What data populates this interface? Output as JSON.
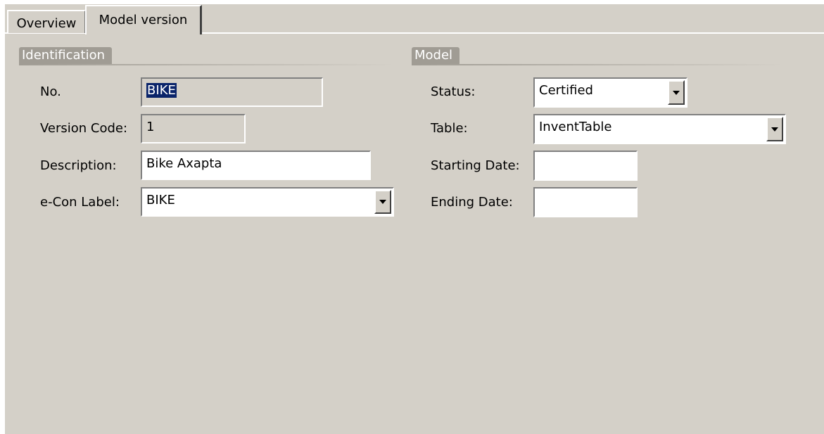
{
  "tabs": [
    {
      "label": "Overview"
    },
    {
      "label": "Model version"
    }
  ],
  "identification": {
    "title": "Identification",
    "no_label": "No.",
    "no_value": "BIKE",
    "version_code_label": "Version Code:",
    "version_code_value": "1",
    "description_label": "Description:",
    "description_value": "Bike Axapta",
    "econ_label_label": "e-Con Label:",
    "econ_label_value": "BIKE"
  },
  "model": {
    "title": "Model",
    "status_label": "Status:",
    "status_value": "Certified",
    "table_label": "Table:",
    "table_value": "InventTable",
    "starting_date_label": "Starting Date:",
    "starting_date_value": "",
    "ending_date_label": "Ending Date:",
    "ending_date_value": ""
  },
  "colors": {
    "panel": "#d4d0c8",
    "group_header": "#a09c94",
    "selection": "#0a246a"
  }
}
